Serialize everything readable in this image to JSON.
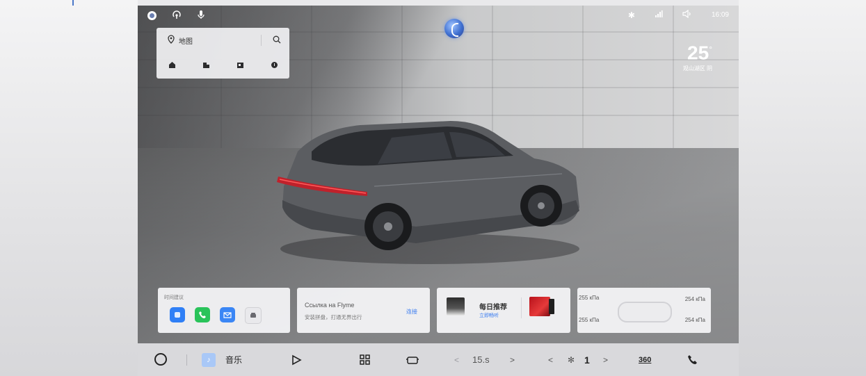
{
  "status": {
    "time": "16:09"
  },
  "weather": {
    "temperature": "25",
    "unit": "°",
    "location": "观山湖区 阴"
  },
  "map_card": {
    "label": "地图",
    "icons": [
      "home-icon",
      "office-icon",
      "photo-icon",
      "info-icon"
    ]
  },
  "cards": {
    "shortcuts": {
      "title": "时间建议",
      "apps": [
        "blue-app-icon",
        "phone-icon",
        "mail-icon",
        "car-icon"
      ]
    },
    "flyme": {
      "title": "Ссылка на Flyme",
      "subtitle": "安装拼盘，打通无界出行",
      "action": "连接"
    },
    "music": {
      "title": "每日推荐",
      "action": "立即畅听"
    },
    "tire_pressure": {
      "front_left": "255 кПа",
      "front_right": "254 кПа",
      "rear_left": "255 кПа",
      "rear_right": "254 кПа"
    }
  },
  "dock": {
    "music_label": "音乐",
    "temperature": "15.s",
    "fan_level": "1",
    "view_360": "360"
  },
  "colors": {
    "accent": "#3a7cf0",
    "card_bg": "#f3f3f5",
    "dock_bg": "#d9d9dc"
  }
}
